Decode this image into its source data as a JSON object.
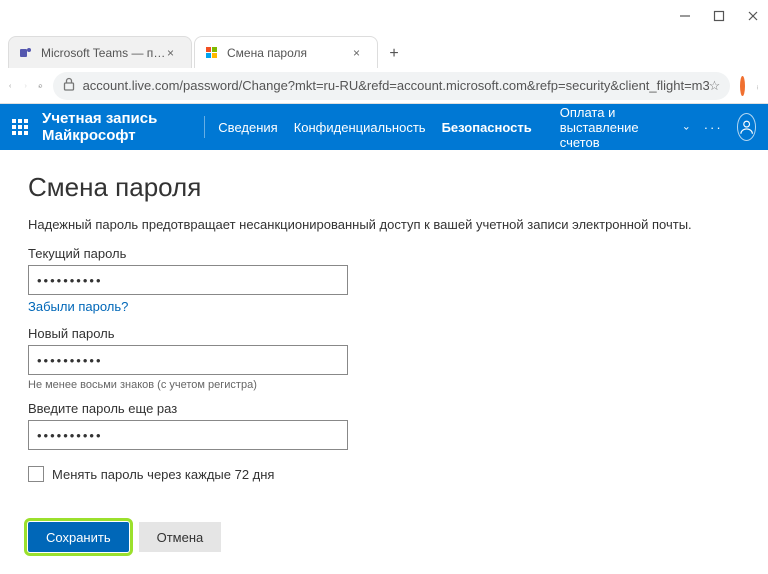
{
  "window": {
    "tabs": [
      {
        "title": "Microsoft Teams — программа д"
      },
      {
        "title": "Смена пароля"
      }
    ],
    "url": "account.live.com/password/Change?mkt=ru-RU&refd=account.microsoft.com&refp=security&client_flight=m3..."
  },
  "header": {
    "brand": "Учетная запись Майкрософт",
    "nav": {
      "info": "Сведения",
      "privacy": "Конфиденциальность",
      "security": "Безопасность",
      "billing": "Оплата и выставление счетов"
    }
  },
  "page": {
    "title": "Смена пароля",
    "description": "Надежный пароль предотвращает несанкционированный доступ к вашей учетной записи электронной почты.",
    "current_label": "Текущий пароль",
    "current_value": "••••••••••",
    "forgot_link": "Забыли пароль?",
    "new_label": "Новый пароль",
    "new_value": "••••••••••",
    "hint": "Не менее восьми знаков (с учетом регистра)",
    "confirm_label": "Введите пароль еще раз",
    "confirm_value": "••••••••••",
    "checkbox_label": "Менять пароль через каждые 72 дня",
    "save": "Сохранить",
    "cancel": "Отмена"
  }
}
